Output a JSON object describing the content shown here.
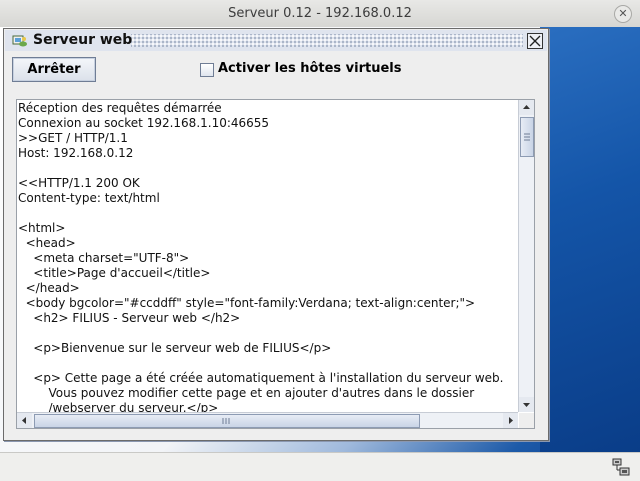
{
  "os_window": {
    "title": "Serveur 0.12 - 192.168.0.12"
  },
  "frame": {
    "title": "Serveur web"
  },
  "controls": {
    "stop_button": "Arrêter",
    "virtual_hosts_label": "Activer les hôtes virtuels",
    "virtual_hosts_checked": false
  },
  "log": {
    "lines": [
      "Réception des requêtes démarrée",
      "Connexion au socket 192.168.1.10:46655",
      ">>GET / HTTP/1.1",
      "Host: 192.168.0.12",
      "",
      "<<HTTP/1.1 200 OK",
      "Content-type: text/html",
      "",
      "<html>",
      "  <head>",
      "    <meta charset=\"UTF-8\">",
      "    <title>Page d'accueil</title>",
      "  </head>",
      "  <body bgcolor=\"#ccddff\" style=\"font-family:Verdana; text-align:center;\">",
      "    <h2> FILIUS - Serveur web </h2>",
      "",
      "    <p>Bienvenue sur le serveur web de FILIUS</p>",
      "",
      "    <p> Cette page a été créée automatiquement à l'installation du serveur web.",
      "        Vous pouvez modifier cette page et en ajouter d'autres dans le dossier",
      "        /webserver du serveur.</p>"
    ]
  },
  "icons": {
    "os_close": "close-icon",
    "frame_app": "server-icon",
    "frame_close": "close-icon",
    "status": "network-icon"
  },
  "colors": {
    "frame_title_bg": "#dfe4ee",
    "desktop_blue": "#1455a8"
  }
}
